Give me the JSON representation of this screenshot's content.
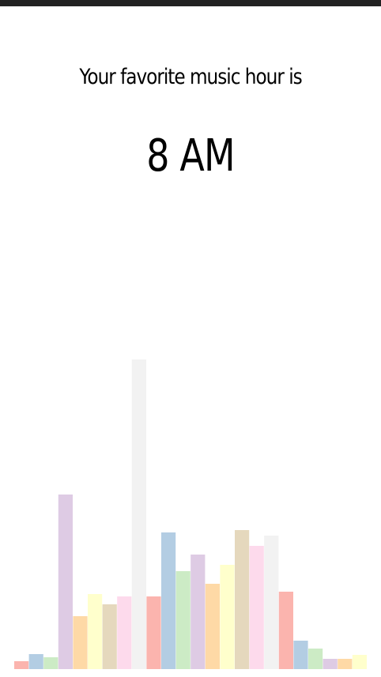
{
  "header": {
    "title": "Your favorite music hour is",
    "hour": "8 AM"
  },
  "chart_data": {
    "type": "bar",
    "categories": [],
    "values": [
      10,
      19,
      15,
      221,
      67,
      95,
      82,
      92,
      392,
      92,
      173,
      124,
      145,
      108,
      132,
      176,
      156,
      169,
      98,
      36,
      26,
      13,
      13,
      18
    ],
    "ylim": [
      0,
      392
    ],
    "colors": [
      "#fbb4ae",
      "#b3cde3",
      "#ccebc5",
      "#decbe4",
      "#fed9a6",
      "#ffffcc",
      "#e5d8bd",
      "#fddaec",
      "#f2f2f2"
    ],
    "grid": false,
    "legend": "none"
  }
}
